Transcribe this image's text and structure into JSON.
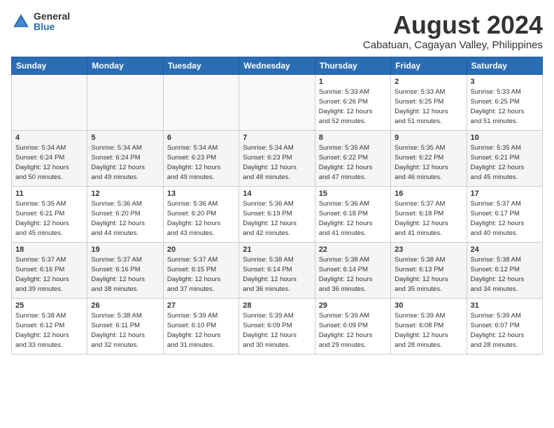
{
  "header": {
    "logo_general": "General",
    "logo_blue": "Blue",
    "month_title": "August 2024",
    "location": "Cabatuan, Cagayan Valley, Philippines"
  },
  "weekdays": [
    "Sunday",
    "Monday",
    "Tuesday",
    "Wednesday",
    "Thursday",
    "Friday",
    "Saturday"
  ],
  "weeks": [
    [
      {
        "day": "",
        "info": ""
      },
      {
        "day": "",
        "info": ""
      },
      {
        "day": "",
        "info": ""
      },
      {
        "day": "",
        "info": ""
      },
      {
        "day": "1",
        "info": "Sunrise: 5:33 AM\nSunset: 6:26 PM\nDaylight: 12 hours\nand 52 minutes."
      },
      {
        "day": "2",
        "info": "Sunrise: 5:33 AM\nSunset: 6:25 PM\nDaylight: 12 hours\nand 51 minutes."
      },
      {
        "day": "3",
        "info": "Sunrise: 5:33 AM\nSunset: 6:25 PM\nDaylight: 12 hours\nand 51 minutes."
      }
    ],
    [
      {
        "day": "4",
        "info": "Sunrise: 5:34 AM\nSunset: 6:24 PM\nDaylight: 12 hours\nand 50 minutes."
      },
      {
        "day": "5",
        "info": "Sunrise: 5:34 AM\nSunset: 6:24 PM\nDaylight: 12 hours\nand 49 minutes."
      },
      {
        "day": "6",
        "info": "Sunrise: 5:34 AM\nSunset: 6:23 PM\nDaylight: 12 hours\nand 49 minutes."
      },
      {
        "day": "7",
        "info": "Sunrise: 5:34 AM\nSunset: 6:23 PM\nDaylight: 12 hours\nand 48 minutes."
      },
      {
        "day": "8",
        "info": "Sunrise: 5:35 AM\nSunset: 6:22 PM\nDaylight: 12 hours\nand 47 minutes."
      },
      {
        "day": "9",
        "info": "Sunrise: 5:35 AM\nSunset: 6:22 PM\nDaylight: 12 hours\nand 46 minutes."
      },
      {
        "day": "10",
        "info": "Sunrise: 5:35 AM\nSunset: 6:21 PM\nDaylight: 12 hours\nand 45 minutes."
      }
    ],
    [
      {
        "day": "11",
        "info": "Sunrise: 5:35 AM\nSunset: 6:21 PM\nDaylight: 12 hours\nand 45 minutes."
      },
      {
        "day": "12",
        "info": "Sunrise: 5:36 AM\nSunset: 6:20 PM\nDaylight: 12 hours\nand 44 minutes."
      },
      {
        "day": "13",
        "info": "Sunrise: 5:36 AM\nSunset: 6:20 PM\nDaylight: 12 hours\nand 43 minutes."
      },
      {
        "day": "14",
        "info": "Sunrise: 5:36 AM\nSunset: 6:19 PM\nDaylight: 12 hours\nand 42 minutes."
      },
      {
        "day": "15",
        "info": "Sunrise: 5:36 AM\nSunset: 6:18 PM\nDaylight: 12 hours\nand 41 minutes."
      },
      {
        "day": "16",
        "info": "Sunrise: 5:37 AM\nSunset: 6:18 PM\nDaylight: 12 hours\nand 41 minutes."
      },
      {
        "day": "17",
        "info": "Sunrise: 5:37 AM\nSunset: 6:17 PM\nDaylight: 12 hours\nand 40 minutes."
      }
    ],
    [
      {
        "day": "18",
        "info": "Sunrise: 5:37 AM\nSunset: 6:16 PM\nDaylight: 12 hours\nand 39 minutes."
      },
      {
        "day": "19",
        "info": "Sunrise: 5:37 AM\nSunset: 6:16 PM\nDaylight: 12 hours\nand 38 minutes."
      },
      {
        "day": "20",
        "info": "Sunrise: 5:37 AM\nSunset: 6:15 PM\nDaylight: 12 hours\nand 37 minutes."
      },
      {
        "day": "21",
        "info": "Sunrise: 5:38 AM\nSunset: 6:14 PM\nDaylight: 12 hours\nand 36 minutes."
      },
      {
        "day": "22",
        "info": "Sunrise: 5:38 AM\nSunset: 6:14 PM\nDaylight: 12 hours\nand 36 minutes."
      },
      {
        "day": "23",
        "info": "Sunrise: 5:38 AM\nSunset: 6:13 PM\nDaylight: 12 hours\nand 35 minutes."
      },
      {
        "day": "24",
        "info": "Sunrise: 5:38 AM\nSunset: 6:12 PM\nDaylight: 12 hours\nand 34 minutes."
      }
    ],
    [
      {
        "day": "25",
        "info": "Sunrise: 5:38 AM\nSunset: 6:12 PM\nDaylight: 12 hours\nand 33 minutes."
      },
      {
        "day": "26",
        "info": "Sunrise: 5:38 AM\nSunset: 6:11 PM\nDaylight: 12 hours\nand 32 minutes."
      },
      {
        "day": "27",
        "info": "Sunrise: 5:39 AM\nSunset: 6:10 PM\nDaylight: 12 hours\nand 31 minutes."
      },
      {
        "day": "28",
        "info": "Sunrise: 5:39 AM\nSunset: 6:09 PM\nDaylight: 12 hours\nand 30 minutes."
      },
      {
        "day": "29",
        "info": "Sunrise: 5:39 AM\nSunset: 6:09 PM\nDaylight: 12 hours\nand 29 minutes."
      },
      {
        "day": "30",
        "info": "Sunrise: 5:39 AM\nSunset: 6:08 PM\nDaylight: 12 hours\nand 28 minutes."
      },
      {
        "day": "31",
        "info": "Sunrise: 5:39 AM\nSunset: 6:07 PM\nDaylight: 12 hours\nand 28 minutes."
      }
    ]
  ]
}
